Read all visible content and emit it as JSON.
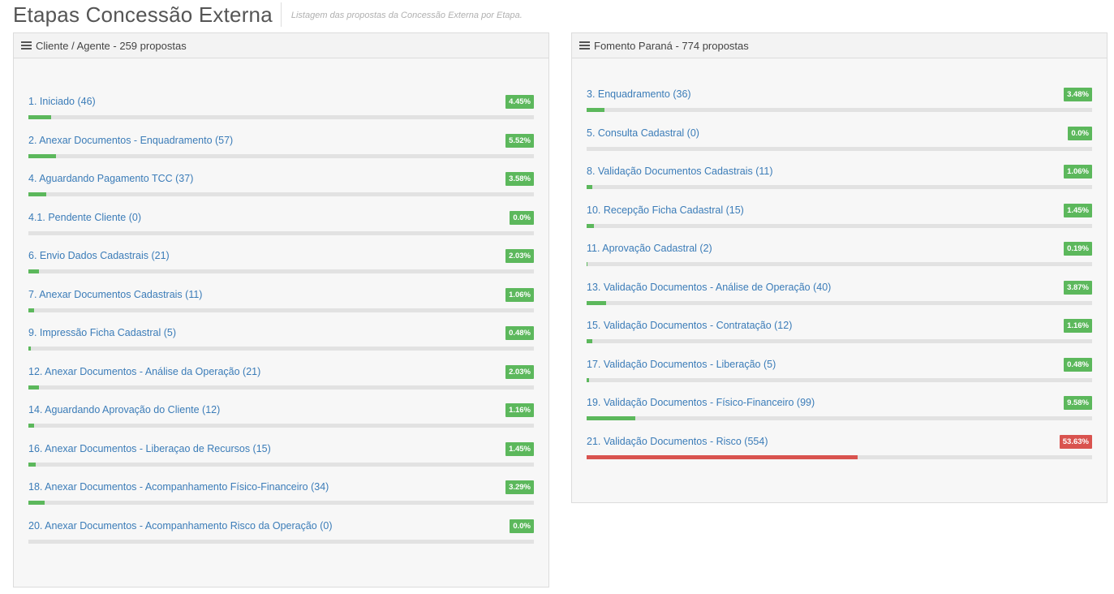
{
  "page": {
    "title": "Etapas Concessão Externa",
    "subtitle": "Listagem das propostas da Concessão Externa por Etapa."
  },
  "panels": [
    {
      "title": "Cliente / Agente - 259 propostas",
      "icon": "list-icon",
      "stages": [
        {
          "label": "1. Iniciado (46)",
          "percent_label": "4.45%",
          "percent": 4.45,
          "status": "success"
        },
        {
          "label": "2. Anexar Documentos - Enquadramento (57)",
          "percent_label": "5.52%",
          "percent": 5.52,
          "status": "success"
        },
        {
          "label": "4. Aguardando Pagamento TCC (37)",
          "percent_label": "3.58%",
          "percent": 3.58,
          "status": "success"
        },
        {
          "label": "4.1. Pendente Cliente (0)",
          "percent_label": "0.0%",
          "percent": 0.0,
          "status": "success"
        },
        {
          "label": "6. Envio Dados Cadastrais (21)",
          "percent_label": "2.03%",
          "percent": 2.03,
          "status": "success"
        },
        {
          "label": "7. Anexar Documentos Cadastrais (11)",
          "percent_label": "1.06%",
          "percent": 1.06,
          "status": "success"
        },
        {
          "label": "9. Impressão Ficha Cadastral (5)",
          "percent_label": "0.48%",
          "percent": 0.48,
          "status": "success"
        },
        {
          "label": "12. Anexar Documentos - Análise da Operação (21)",
          "percent_label": "2.03%",
          "percent": 2.03,
          "status": "success"
        },
        {
          "label": "14. Aguardando Aprovação do Cliente (12)",
          "percent_label": "1.16%",
          "percent": 1.16,
          "status": "success"
        },
        {
          "label": "16. Anexar Documentos - Liberaçao de Recursos (15)",
          "percent_label": "1.45%",
          "percent": 1.45,
          "status": "success"
        },
        {
          "label": "18. Anexar Documentos - Acompanhamento Físico-Financeiro (34)",
          "percent_label": "3.29%",
          "percent": 3.29,
          "status": "success"
        },
        {
          "label": "20. Anexar Documentos - Acompanhamento Risco da Operação (0)",
          "percent_label": "0.0%",
          "percent": 0.0,
          "status": "success"
        }
      ]
    },
    {
      "title": "Fomento Paraná - 774 propostas",
      "icon": "list-icon",
      "stages": [
        {
          "label": "3. Enquadramento (36)",
          "percent_label": "3.48%",
          "percent": 3.48,
          "status": "success"
        },
        {
          "label": "5. Consulta Cadastral (0)",
          "percent_label": "0.0%",
          "percent": 0.0,
          "status": "success"
        },
        {
          "label": "8. Validação Documentos Cadastrais (11)",
          "percent_label": "1.06%",
          "percent": 1.06,
          "status": "success"
        },
        {
          "label": "10. Recepção Ficha Cadastral (15)",
          "percent_label": "1.45%",
          "percent": 1.45,
          "status": "success"
        },
        {
          "label": "11. Aprovação Cadastral (2)",
          "percent_label": "0.19%",
          "percent": 0.19,
          "status": "success"
        },
        {
          "label": "13. Validação Documentos - Análise de Operação (40)",
          "percent_label": "3.87%",
          "percent": 3.87,
          "status": "success"
        },
        {
          "label": "15. Validação Documentos - Contratação (12)",
          "percent_label": "1.16%",
          "percent": 1.16,
          "status": "success"
        },
        {
          "label": "17. Validação Documentos - Liberação (5)",
          "percent_label": "0.48%",
          "percent": 0.48,
          "status": "success"
        },
        {
          "label": "19. Validação Documentos - Físico-Financeiro (99)",
          "percent_label": "9.58%",
          "percent": 9.58,
          "status": "success"
        },
        {
          "label": "21. Validação Documentos - Risco (554)",
          "percent_label": "53.63%",
          "percent": 53.63,
          "status": "danger"
        }
      ]
    }
  ],
  "colors": {
    "success": "#5cb85c",
    "danger": "#d9534f",
    "link": "#3b7cb8",
    "track": "#e2e2e2"
  }
}
